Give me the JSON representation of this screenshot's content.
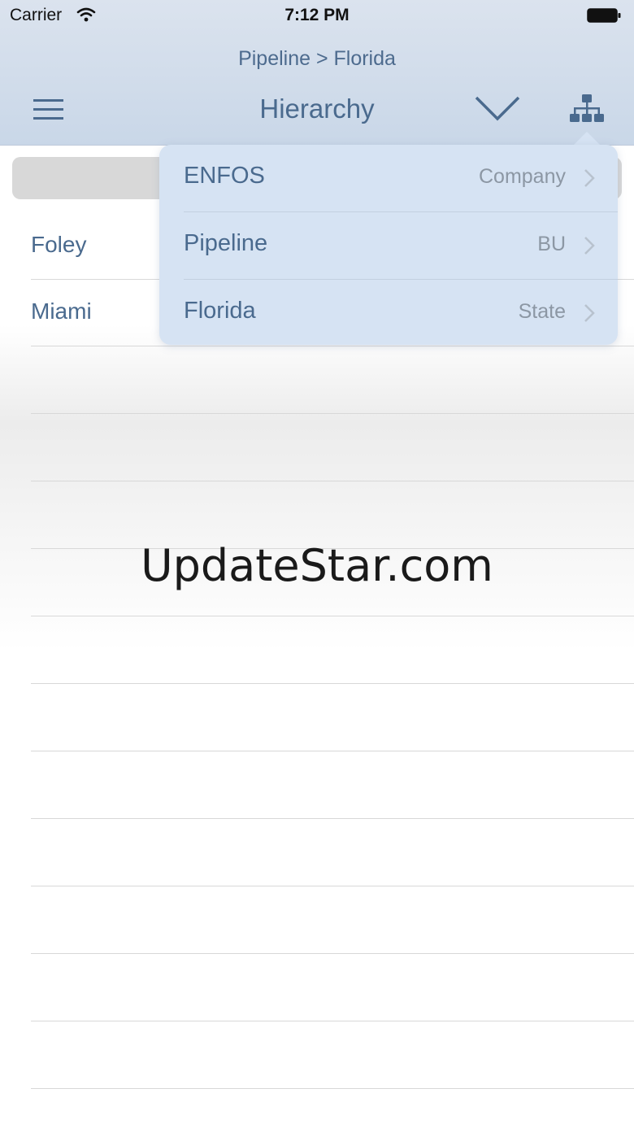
{
  "status_bar": {
    "carrier": "Carrier",
    "time": "7:12 PM"
  },
  "header": {
    "breadcrumb": "Pipeline > Florida",
    "title": "Hierarchy"
  },
  "list": {
    "items": [
      "Foley",
      "Miami"
    ]
  },
  "popover": {
    "items": [
      {
        "name": "ENFOS",
        "type": "Company"
      },
      {
        "name": "Pipeline",
        "type": "BU"
      },
      {
        "name": "Florida",
        "type": "State"
      }
    ]
  },
  "watermark": "UpdateStar.com",
  "colors": {
    "accent": "#4a6a8e",
    "header_bg": "#c9d7e8",
    "popover_bg": "#d6e3f3"
  }
}
